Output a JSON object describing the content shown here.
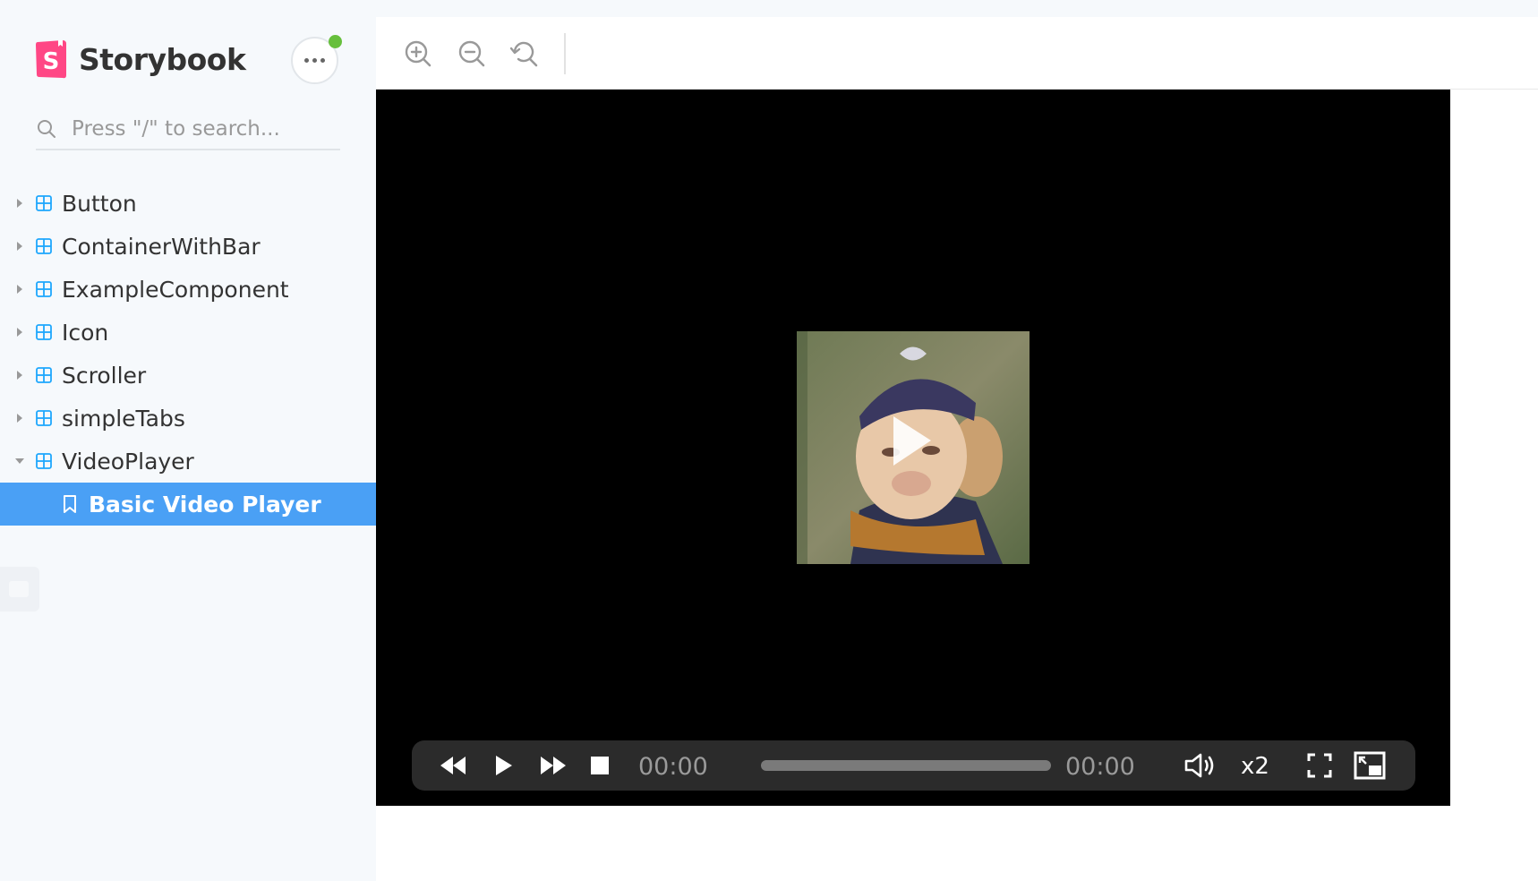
{
  "brand": {
    "name": "Storybook"
  },
  "search": {
    "placeholder": "Press \"/\" to search..."
  },
  "sidebar": {
    "items": [
      {
        "label": "Button"
      },
      {
        "label": "ContainerWithBar"
      },
      {
        "label": "ExampleComponent"
      },
      {
        "label": "Icon"
      },
      {
        "label": "Scroller"
      },
      {
        "label": "simpleTabs"
      },
      {
        "label": "VideoPlayer",
        "expanded": true
      },
      {
        "label": "Basic Video Player",
        "selected": true,
        "type": "story"
      }
    ]
  },
  "toolbar": {
    "buttons": [
      "zoom-in-icon",
      "zoom-out-icon",
      "zoom-reset-icon"
    ]
  },
  "player": {
    "current_time": "00:00",
    "duration": "00:00",
    "progress": 0,
    "speed": "x2"
  },
  "colors": {
    "accent": "#4aa0f5",
    "brand": "#ff4785",
    "status": "#66bf3c",
    "player_bg": "#000000",
    "controls_bg": "#2b2b2b"
  }
}
